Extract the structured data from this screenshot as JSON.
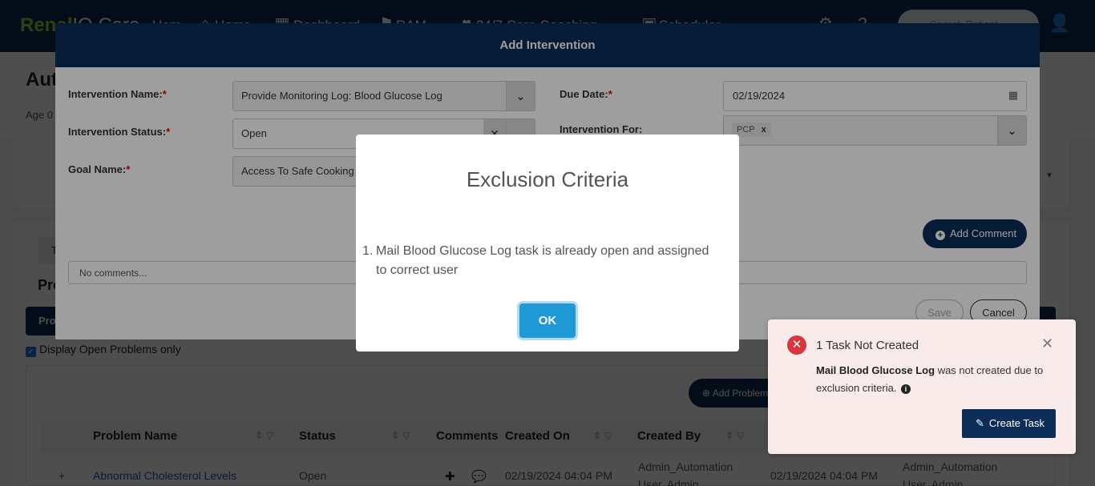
{
  "nav": {
    "brand_a": "Renal",
    "brand_b": "IQ Care",
    "items": [
      "Hom",
      "Home",
      "Dashboard",
      "RAM",
      "24/7 Care Coaching",
      "Scheduler"
    ],
    "search_placeholder": "Search Patient"
  },
  "page": {
    "title": "Aut",
    "subtitle": "Age 0",
    "tab_initial": "T",
    "problems_title": "Pro",
    "problems_tab": "Pro",
    "display_open_label": "Display Open Problems only",
    "add_problem_label": "Add Problem"
  },
  "grid": {
    "headers": [
      "Problem Name",
      "Status",
      "Comments",
      "Created On",
      "Created By"
    ],
    "row": {
      "expand": "+",
      "problem": "Abnormal Cholesterol Levels",
      "status": "Open",
      "created_on": "02/19/2024 04:04 PM",
      "created_by_1": "Admin_Automation",
      "created_by_2": "User, Admin",
      "created_on_2": "02/19/2024 04:04 PM",
      "modified_by_1": "Admin_Automation",
      "modified_by_2": "User, Admin"
    }
  },
  "intervention_modal": {
    "title": "Add Intervention",
    "fields": {
      "name_label": "Intervention Name:",
      "name_value": "Provide Monitoring Log: Blood Glucose Log",
      "status_label": "Intervention Status:",
      "status_value": "Open",
      "goal_label": "Goal Name:",
      "goal_value": "Access To Safe Cooking",
      "due_label": "Due Date:",
      "due_value": "02/19/2024",
      "for_label": "Intervention For:",
      "for_chip": "PCP"
    },
    "required_mark": "*",
    "add_comment": "Add Comment",
    "comments_placeholder": "No comments...",
    "save": "Save",
    "cancel": "Cancel"
  },
  "exclusion_dialog": {
    "title": "Exclusion Criteria",
    "item_number": "1.",
    "item_text": "Mail Blood Glucose Log task is already open and assigned to correct user",
    "ok": "OK"
  },
  "toast": {
    "title": "1 Task Not Created",
    "task_name": "Mail Blood Glucose Log",
    "message": "was not created due to exclusion criteria.",
    "button": "Create Task"
  },
  "colors": {
    "navy": "#0b2d57",
    "accent_green": "#9acd32",
    "ok_blue": "#1f9ad6",
    "error_red": "#d9363e",
    "toast_bg": "#f9ebe9"
  }
}
